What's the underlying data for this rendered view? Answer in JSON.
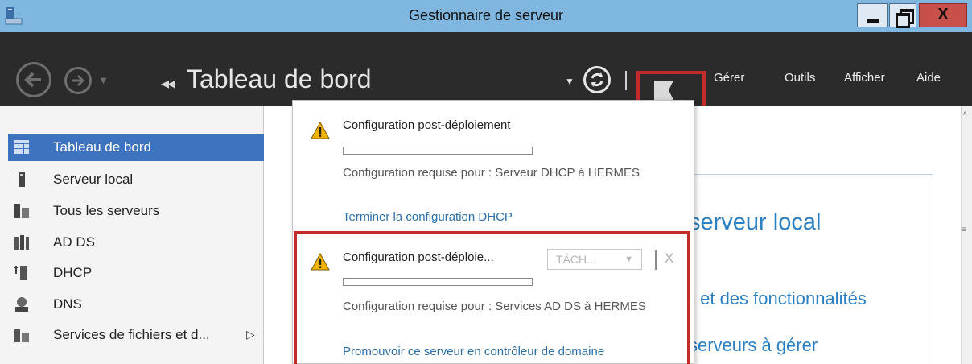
{
  "window": {
    "title": "Gestionnaire de serveur",
    "close_glyph": "X"
  },
  "header": {
    "title": "Tableau de bord",
    "breadcrumb_glyph": "◂◂",
    "menu": [
      "Gérer",
      "Outils",
      "Afficher",
      "Aide"
    ]
  },
  "sidebar": {
    "items": [
      {
        "label": "Tableau de bord",
        "icon": "dashboard-icon",
        "active": true
      },
      {
        "label": "Serveur local",
        "icon": "server-icon"
      },
      {
        "label": "Tous les serveurs",
        "icon": "servers-icon"
      },
      {
        "label": "AD DS",
        "icon": "ad-ds-icon"
      },
      {
        "label": "DHCP",
        "icon": "dhcp-icon"
      },
      {
        "label": "DNS",
        "icon": "dns-icon"
      },
      {
        "label": "Services de fichiers et d...",
        "icon": "file-services-icon",
        "expand_glyph": "▷"
      }
    ]
  },
  "background": {
    "fragments": [
      "serveur local",
      "s et des fonctionnalités",
      "serveurs à gérer"
    ]
  },
  "notifications": [
    {
      "title": "Configuration post-déploiement",
      "description": "Configuration requise pour : Serveur DHCP à HERMES",
      "link": "Terminer la configuration DHCP"
    },
    {
      "title": "Configuration post-déploie...",
      "task_button": "TÂCH...",
      "close": "X",
      "description": "Configuration requise pour : Services AD DS à HERMES",
      "link": "Promouvoir ce serveur en contrôleur de domaine"
    }
  ],
  "colors": {
    "titlebar": "#7fb7e0",
    "header": "#2b2b2b",
    "active_item": "#3e73c0",
    "highlight": "#c32a2a",
    "link": "#2b6ea8",
    "warning": "#f0b400"
  }
}
